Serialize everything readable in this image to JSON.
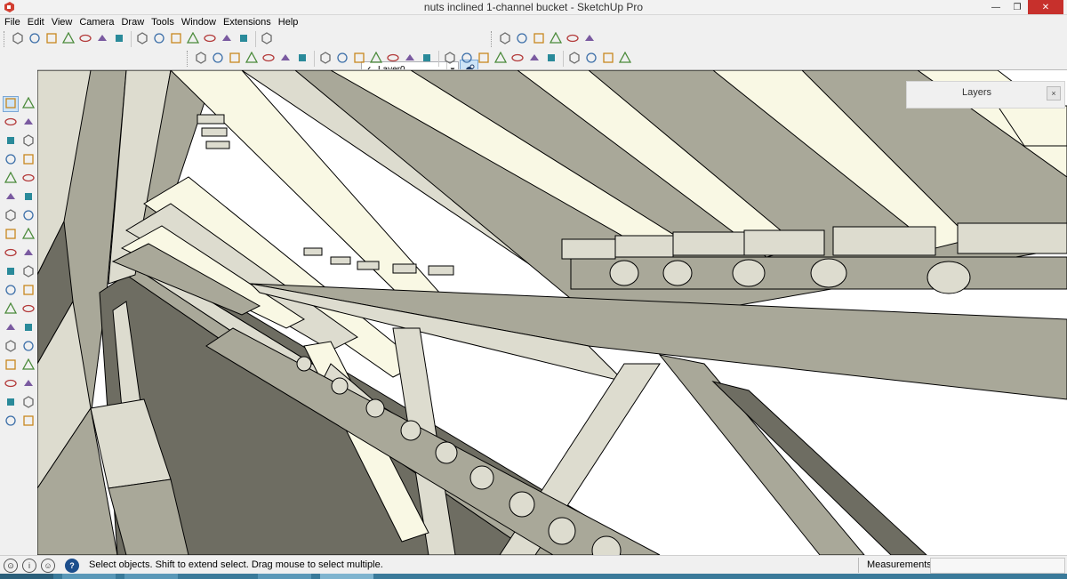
{
  "window": {
    "title": "nuts inclined 1-channel bucket - SketchUp Pro",
    "controls": [
      "minimize",
      "maximize",
      "close"
    ]
  },
  "menubar": {
    "items": [
      "File",
      "Edit",
      "View",
      "Camera",
      "Draw",
      "Tools",
      "Window",
      "Extensions",
      "Help"
    ]
  },
  "toolbars": {
    "row1_icons": [
      "push-pull-icon",
      "rotate-view-icon",
      "shape-1-icon",
      "cone-icon",
      "cylinder-icon",
      "sphere-icon",
      "tube-icon",
      "dome-icon",
      "ellipse-icon",
      "torus-icon",
      "globe-1-icon",
      "globe-2-icon",
      "globe-3-icon",
      "helix-icon",
      "magnet-icon"
    ],
    "layer": {
      "current": "Layer0",
      "check": "✓"
    },
    "row1_right_icons": [
      "camera-1-icon",
      "camera-2-icon",
      "camera-3-icon",
      "camera-4-icon",
      "camera-5-icon",
      "camera-6-icon"
    ],
    "row2_icons": [
      "hand-icon",
      "select-user-icon",
      "warehouse-icon",
      "box-1-icon",
      "box-2-icon",
      "box-3-icon",
      "component-icon",
      "leaf-icon",
      "stairs-icon",
      "mirror-icon",
      "slice-icon",
      "cube-front-icon",
      "house-1-icon",
      "house-2-icon",
      "house-3-icon",
      "home-icon",
      "house-4-icon",
      "iso-view-icon",
      "top-view-icon",
      "front-view-icon",
      "right-view-icon",
      "back-view-icon",
      "left-view-icon",
      "bottom-view-icon",
      "section-icon"
    ]
  },
  "left_toolbar": {
    "icons": [
      "select-icon",
      "make-component-icon",
      "paint-bucket-icon",
      "eraser-icon",
      "pencil-icon",
      "freehand-icon",
      "rectangle-icon",
      "rotated-rect-icon",
      "circle-icon",
      "polygon-icon",
      "arc-icon",
      "pie-icon",
      "two-point-arc-icon",
      "three-point-arc-icon",
      "move-icon",
      "push-pull-icon",
      "rotate-icon",
      "follow-me-icon",
      "scale-icon",
      "offset-icon",
      "tape-measure-icon",
      "dimension-icon",
      "protractor-icon",
      "text-icon",
      "axes-icon",
      "3d-text-icon",
      "orbit-icon",
      "pan-icon",
      "zoom-icon",
      "zoom-window-icon",
      "zoom-extents-icon",
      "previous-view-icon",
      "walk-icon",
      "look-around-icon",
      "footprint-icon",
      "position-camera-icon"
    ]
  },
  "panel": {
    "title": "Layers",
    "close": "×"
  },
  "status": {
    "message": "Select objects. Shift to extend select. Drag mouse to select multiple.",
    "help": "?",
    "info": "i",
    "measurements_label": "Measurements",
    "measurements_value": ""
  },
  "colors": {
    "model_face": "#dddccf",
    "model_shadow": "#a9a899",
    "model_dark": "#6e6d62",
    "model_light": "#f9f8e4",
    "edge": "#000000",
    "highlight": "#cde4f7",
    "close_red": "#c7302c"
  }
}
